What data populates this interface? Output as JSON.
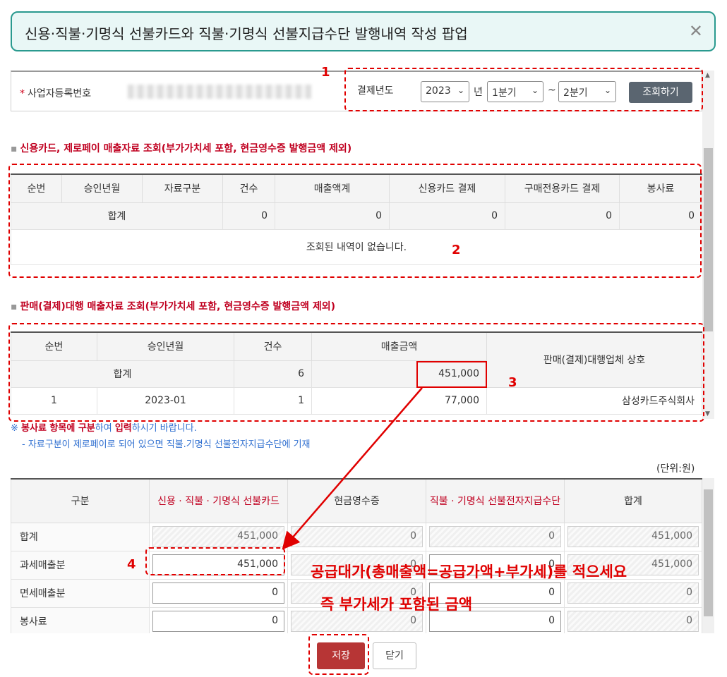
{
  "popup": {
    "title": "신용·직불·기명식 선불카드와 직불·기명식 선불지급수단 발행내역 작성 팝업",
    "close_icon": "close-icon"
  },
  "search": {
    "biz_label": "사업자등록번호",
    "year_label": "결제년도",
    "year_value": "2023",
    "year_suffix": "년",
    "from_quarter": "1분기",
    "tilde": "~",
    "to_quarter": "2분기",
    "query_button": "조회하기"
  },
  "section1": {
    "title": "신용카드, 제로페이 매출자료 조회(부가가치세 포함, 현금영수증 발행금액 제외)",
    "columns": [
      "순번",
      "승인년월",
      "자료구분",
      "건수",
      "매출액계",
      "신용카드 결제",
      "구매전용카드 결제",
      "봉사료"
    ],
    "total_label": "합계",
    "totals": [
      "0",
      "0",
      "0",
      "0",
      "0"
    ],
    "empty_message": "조회된 내역이 없습니다."
  },
  "section2": {
    "title": "판매(결제)대행 매출자료 조회(부가가치세 포함, 현금영수증 발행금액 제외)",
    "columns": [
      "순번",
      "승인년월",
      "건수",
      "매출금액",
      "판매(결제)대행업체 상호"
    ],
    "total_label": "합계",
    "total_count": "6",
    "total_amount": "451,000",
    "rows": [
      {
        "no": "1",
        "month": "2023-01",
        "count": "1",
        "amount": "77,000",
        "company": "삼성카드주식회사"
      }
    ]
  },
  "notes": {
    "line1_red": "봉사료 항목에 구분",
    "line1_mid": "하여 ",
    "line1_red2": "입력",
    "line1_tail": "하시기 바랍니다.",
    "line2": "- 자료구분이 제로페이로 되어 있으면 직불.기명식 선불전자지급수단에 기재"
  },
  "lower": {
    "unit": "(단위:원)",
    "columns": [
      "구분",
      "신용 · 직불 · 기명식 선불카드",
      "현금영수증",
      "직불 · 기명식 선불전자지급수단",
      "합계"
    ],
    "rows": [
      {
        "label": "합계",
        "values": [
          "451,000",
          "0",
          "0",
          "451,000"
        ]
      },
      {
        "label": "과세매출분",
        "values": [
          "451,000",
          "0",
          "0",
          "451,000"
        ]
      },
      {
        "label": "면세매출분",
        "values": [
          "0",
          "0",
          "0",
          "0"
        ]
      },
      {
        "label": "봉사료",
        "values": [
          "0",
          "0",
          "0",
          "0"
        ]
      }
    ]
  },
  "buttons": {
    "save": "저장",
    "close": "닫기"
  },
  "annotations": {
    "n1": "1",
    "n2": "2",
    "n3": "3",
    "n4": "4",
    "callout1": "공급대가(총매출액=공급가액+부가세)를 적으세요",
    "callout2": "즉 부가세가 포함된 금액"
  },
  "colors": {
    "accent": "#2a9a8f",
    "annotation": "#e00000",
    "save": "#b73535"
  }
}
